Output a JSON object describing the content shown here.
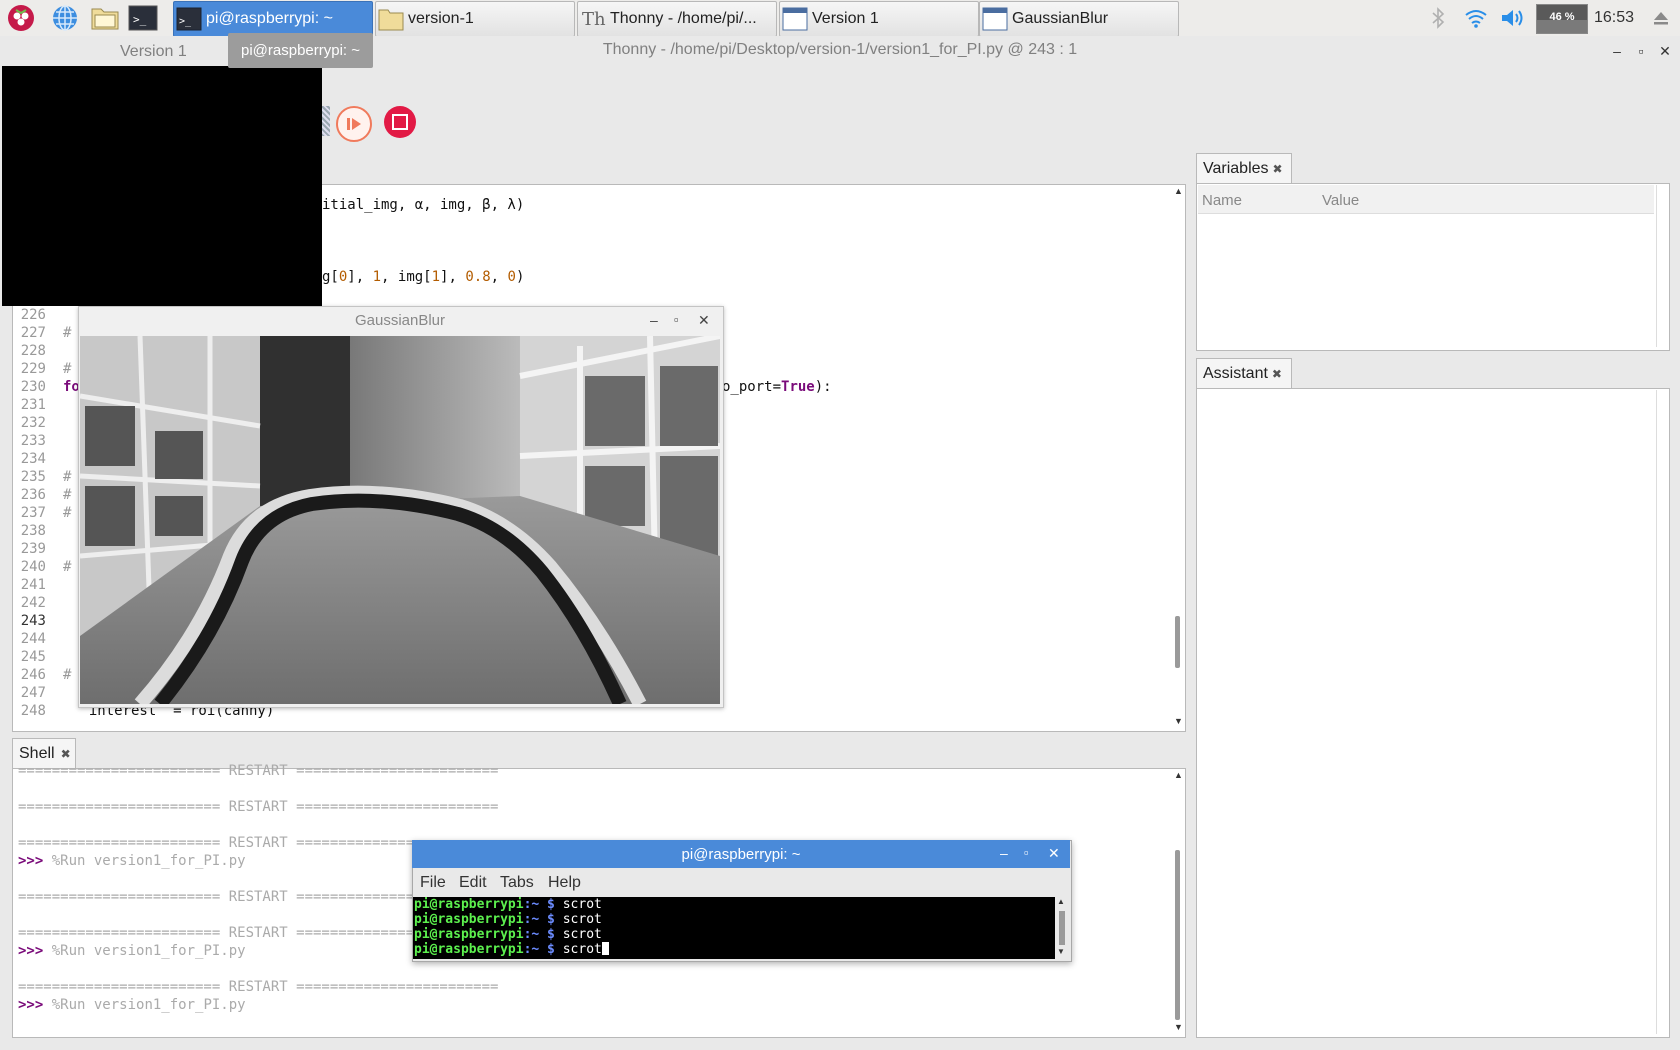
{
  "taskbar": {
    "launchers": [
      "raspberry-menu-icon",
      "web-browser-icon",
      "file-manager-icon",
      "terminal-launcher-icon"
    ],
    "tasks": [
      {
        "label": "pi@raspberrypi: ~",
        "icon": "terminal-icon",
        "active": true
      },
      {
        "label": "version-1",
        "icon": "folder-icon",
        "active": false
      },
      {
        "label": "Thonny  -  /home/pi/...",
        "icon": "thonny-icon",
        "active": false
      },
      {
        "label": "Version 1",
        "icon": "window-icon",
        "active": false
      },
      {
        "label": "GaussianBlur",
        "icon": "window-icon",
        "active": false
      }
    ],
    "cpu": "46 %",
    "clock": "16:53"
  },
  "tooltip": "pi@raspberrypi: ~",
  "thonny": {
    "title": "Thonny  -  /home/pi/Desktop/version-1/version1_for_PI.py  @  243 : 1",
    "version_window_title": "Version 1"
  },
  "editor": {
    "top_lines": [
      "itial_img, α, img, β, λ)",
      "g[0], 1, img[1], 0.8, 0)"
    ],
    "line_numbers": [
      "226",
      "227",
      "228",
      "229",
      "230",
      "231",
      "232",
      "233",
      "234",
      "235",
      "236",
      "237",
      "238",
      "239",
      "240",
      "241",
      "242",
      "243",
      "244",
      "245",
      "246",
      "247",
      "248"
    ],
    "current_line": "243",
    "line230_tail_a": "o_port=",
    "line230_tail_kw": "True",
    "line230_tail_b": "):",
    "hash_marker": "#",
    "for_kw": "fo",
    "line248": "  interest  = roi(canny)"
  },
  "gaussian": {
    "title": "GaussianBlur"
  },
  "shell": {
    "tab_label": "Shell",
    "restart": "======================== RESTART ========================",
    "run_command": "%Run version1_for_PI.py",
    "prompt": ">>>"
  },
  "terminal": {
    "title": "pi@raspberrypi: ~",
    "menu": [
      "File",
      "Edit",
      "Tabs",
      "Help"
    ],
    "user": "pi@raspberrypi",
    "path": ":~ $",
    "command": "scrot"
  },
  "variables": {
    "tab_label": "Variables",
    "col_name": "Name",
    "col_value": "Value"
  },
  "assistant": {
    "tab_label": "Assistant"
  },
  "colors": {
    "accent": "#4a8ad9",
    "stop": "#e21a45",
    "debug": "#f07a5c",
    "keyword": "#7a0b7a",
    "number": "#b35c00"
  }
}
